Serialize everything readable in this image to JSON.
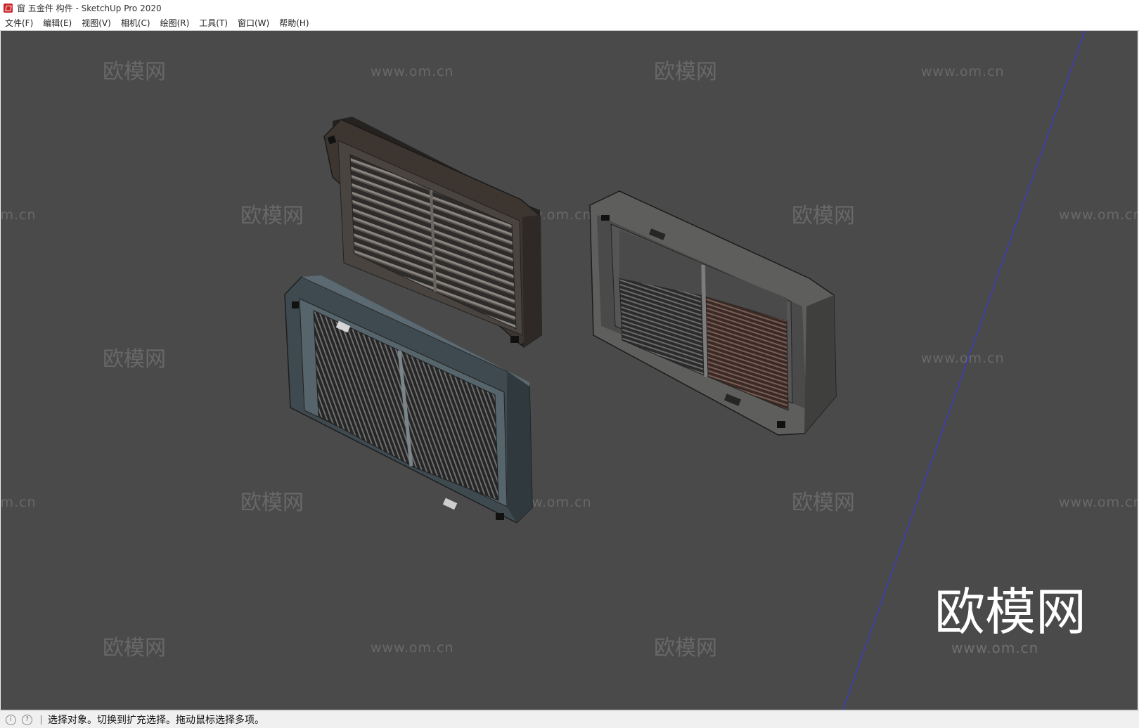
{
  "window": {
    "title": "窗 五金件 构件 - SketchUp Pro 2020",
    "app_icon": "sketchup-icon"
  },
  "menu": {
    "items": [
      "文件(F)",
      "编辑(E)",
      "视图(V)",
      "相机(C)",
      "绘图(R)",
      "工具(T)",
      "窗口(W)",
      "帮助(H)"
    ]
  },
  "viewport": {
    "background_color": "#4a4a4a",
    "axis_color": "#3a3ad8",
    "watermark_text": "欧模网",
    "watermark_url": "www.om.cn",
    "logo_text": "欧模网",
    "logo_url": "www.om.cn",
    "objects": [
      "dark-brown-vent-grille",
      "gray-blue-vent-grille",
      "open-gray-vent-frame"
    ]
  },
  "status": {
    "icons": [
      "info-icon",
      "help-icon"
    ],
    "text": "选择对象。切换到扩充选择。拖动鼠标选择多项。"
  }
}
